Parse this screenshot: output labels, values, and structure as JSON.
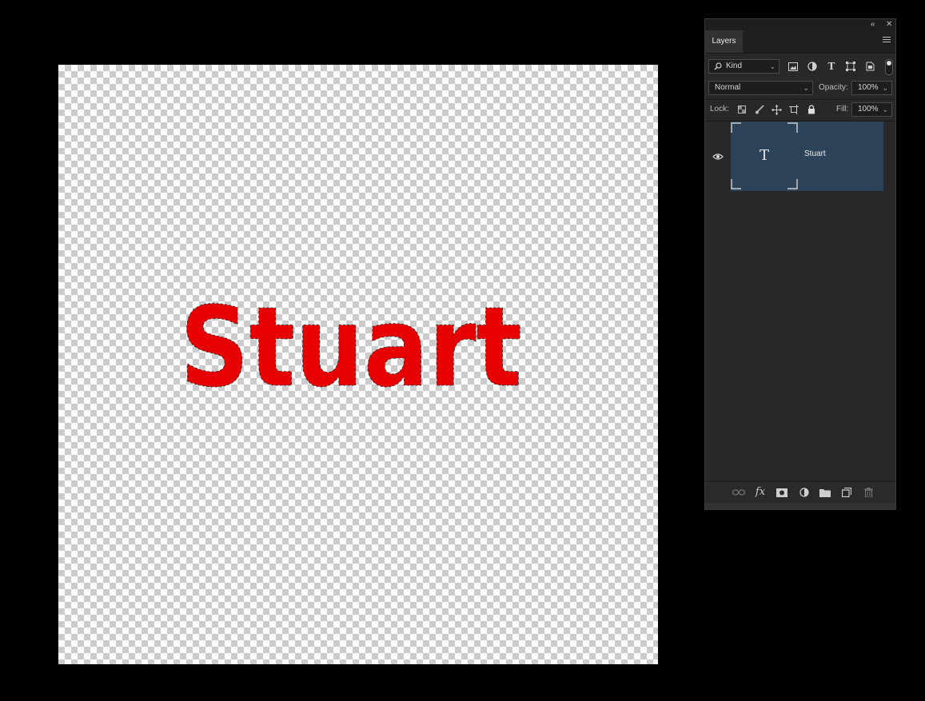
{
  "canvas": {
    "text_layer_content": "Stuart",
    "text_color": "#e60000"
  },
  "panel": {
    "top_controls": {
      "collapse_icon": "double-chevron-left-icon",
      "close_icon": "close-icon"
    },
    "tab_label": "Layers",
    "menu_icon": "hamburger-icon",
    "filter": {
      "value": "Kind",
      "icon": "search-icon"
    },
    "filter_icons": [
      "image-filter-icon",
      "adjustment-filter-icon",
      "type-filter-icon",
      "shape-filter-icon",
      "smart-object-filter-icon"
    ],
    "blend_mode": "Normal",
    "opacity_label": "Opacity:",
    "opacity_value": "100%",
    "lock_label": "Lock:",
    "lock_icons": [
      "lock-transparent-icon",
      "lock-brush-icon",
      "lock-move-icon",
      "lock-artboard-icon",
      "lock-all-icon"
    ],
    "fill_label": "Fill:",
    "fill_value": "100%",
    "layers": [
      {
        "name": "Stuart",
        "type": "text",
        "thumb_glyph": "T",
        "visible": true,
        "selected": true
      }
    ],
    "selection_color": "#2d4359",
    "bottom_icons": [
      "link-layers-icon",
      "fx-icon",
      "layer-mask-icon",
      "adjustment-layer-icon",
      "group-folder-icon",
      "new-layer-icon",
      "trash-icon"
    ]
  }
}
